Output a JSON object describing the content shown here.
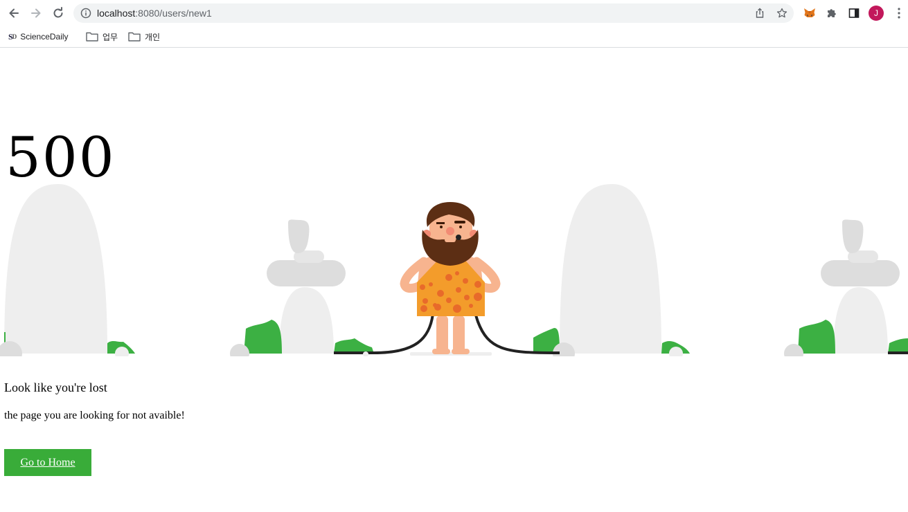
{
  "browser": {
    "url_host": "localhost",
    "url_rest": ":8080/users/new1",
    "profile_initial": "J",
    "avatar_color": "#c2185b",
    "icons": [
      "back-icon",
      "forward-icon",
      "reload-icon",
      "info-icon",
      "share-icon",
      "star-icon",
      "metamask-icon",
      "extensions-icon",
      "side-panel-icon",
      "menu-icon"
    ],
    "bookmarks": [
      {
        "label": "ScienceDaily",
        "icon": "sciencedaily-icon"
      },
      {
        "label": "업무",
        "icon": "folder-icon"
      },
      {
        "label": "개인",
        "icon": "folder-icon"
      }
    ]
  },
  "page": {
    "error_code": "500",
    "heading": "Look like you're lost",
    "subtext": "the page you are looking for not avaible!",
    "home_button": "Go to Home",
    "accent_color": "#39ac39"
  }
}
